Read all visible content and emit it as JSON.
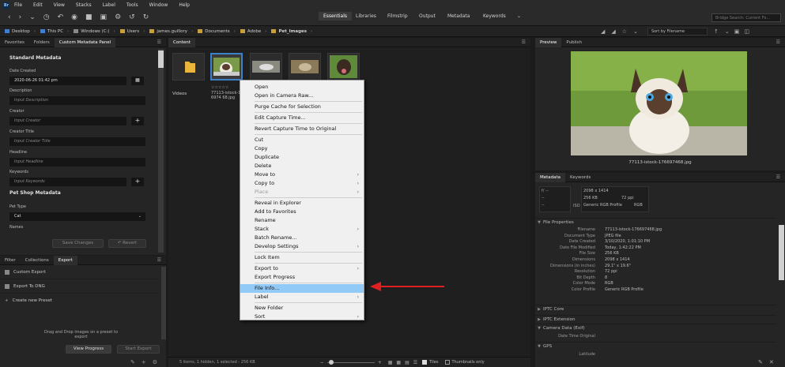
{
  "menubar": {
    "items": [
      "File",
      "Edit",
      "View",
      "Stacks",
      "Label",
      "Tools",
      "Window",
      "Help"
    ]
  },
  "workspaces": {
    "items": [
      "Essentials",
      "Libraries",
      "Filmstrip",
      "Output",
      "Metadata",
      "Keywords"
    ],
    "active": "Essentials"
  },
  "search": {
    "placeholder": "Bridge Search: Current Fo..."
  },
  "breadcrumb": [
    "Desktop",
    "This PC",
    "Windows (C:)",
    "Users",
    "james.guillory",
    "Documents",
    "Adobe",
    "Pet_Images"
  ],
  "sort": {
    "label": "Sort by Filename"
  },
  "left_panel": {
    "tabs": [
      "Favorites",
      "Folders",
      "Custom Metadata Panel"
    ],
    "section1": "Standard Metadata",
    "date_label": "Date Created",
    "date_value": "2020-06-26 01:42 pm",
    "desc_label": "Description",
    "desc_ph": "Input Description",
    "creator_label": "Creator",
    "creator_ph": "Input Creator",
    "ctitle_label": "Creator Title",
    "ctitle_ph": "Input Creator Title",
    "headline_label": "Headline",
    "headline_ph": "Input Headline",
    "keywords_label": "Keywords",
    "keywords_ph": "Input Keywords",
    "section2": "Pet Shop Metadata",
    "pettype_label": "Pet Type",
    "pettype_value": "Cat",
    "names_label": "Names",
    "save_btn": "Save Changes",
    "revert_btn": "Revert"
  },
  "export_panel": {
    "tabs": [
      "Filter",
      "Collections",
      "Export"
    ],
    "items": [
      "Custom Export",
      "Export To DNG",
      "Create new Preset"
    ],
    "drop_hint": "Drag and Drop images on a preset to export",
    "view_progress": "View Progress",
    "start_export": "Start Export"
  },
  "content": {
    "tab": "Content",
    "folder_label": "Videos",
    "sel_stars": "☆☆☆☆☆",
    "sel_name": "77113-istock-1766974 68.jpg",
    "status": "5 items, 1 hidden, 1 selected - 256 KB",
    "tiles_label": "Tiles",
    "thumbs_only": "Thumbnails only"
  },
  "context_menu": {
    "groups": [
      [
        {
          "label": "Open"
        },
        {
          "label": "Open in Camera Raw..."
        }
      ],
      [
        {
          "label": "Purge Cache for Selection"
        }
      ],
      [
        {
          "label": "Edit Capture Time..."
        }
      ],
      [
        {
          "label": "Revert Capture Time to Original"
        }
      ],
      [
        {
          "label": "Cut"
        },
        {
          "label": "Copy"
        },
        {
          "label": "Duplicate"
        },
        {
          "label": "Delete"
        },
        {
          "label": "Move to",
          "sub": true
        },
        {
          "label": "Copy to",
          "sub": true
        },
        {
          "label": "Place",
          "sub": true,
          "disabled": true
        }
      ],
      [
        {
          "label": "Reveal in Explorer"
        },
        {
          "label": "Add to Favorites"
        },
        {
          "label": "Rename"
        },
        {
          "label": "Stack",
          "sub": true
        },
        {
          "label": "Batch Rename..."
        },
        {
          "label": "Develop Settings",
          "sub": true
        }
      ],
      [
        {
          "label": "Lock Item"
        }
      ],
      [
        {
          "label": "Export to",
          "sub": true
        },
        {
          "label": "Export Progress"
        }
      ],
      [
        {
          "label": "File Info...",
          "highlight": true
        },
        {
          "label": "Label",
          "sub": true
        }
      ],
      [
        {
          "label": "New Folder"
        },
        {
          "label": "Sort",
          "sub": true
        }
      ]
    ]
  },
  "preview": {
    "tabs": [
      "Preview",
      "Publish"
    ],
    "caption": "77113-istock-176697468.jpg"
  },
  "metadata": {
    "tabs": [
      "Metadata",
      "Keywords"
    ],
    "summary": {
      "aperture": "f/ --",
      "dims": "2098 x 1414",
      "size": "256 KB",
      "ppi": "72 ppi",
      "iso": "ISO --",
      "profile": "Generic RGB Profile",
      "rgb": "RGB",
      "dash1": "--",
      "dash2": "--",
      "dash3": "--"
    },
    "file_props_label": "File Properties",
    "file_props": [
      {
        "k": "Filename",
        "v": "77113-istock-176697468.jpg"
      },
      {
        "k": "Document Type",
        "v": "JPEG file"
      },
      {
        "k": "Date Created",
        "v": "3/10/2020, 1:01:10 PM"
      },
      {
        "k": "Date File Modified",
        "v": "Today, 1:42:22 PM"
      },
      {
        "k": "File Size",
        "v": "256 KB"
      },
      {
        "k": "Dimensions",
        "v": "2098 x 1414"
      },
      {
        "k": "Dimensions (in inches)",
        "v": "29.1\" x 19.6\""
      },
      {
        "k": "Resolution",
        "v": "72 ppi"
      },
      {
        "k": "Bit Depth",
        "v": "8"
      },
      {
        "k": "Color Mode",
        "v": "RGB"
      },
      {
        "k": "Color Profile",
        "v": "Generic RGB Profile"
      }
    ],
    "sections": [
      "IPTC Core",
      "IPTC Extension",
      "Camera Data (Exif)"
    ],
    "exif_row": "Date Time Original",
    "gps_label": "GPS",
    "latitude": "Latitude"
  },
  "colors": {
    "accent": "#91c9f7",
    "arrow": "#e02020",
    "folder": "#e9b53a"
  }
}
